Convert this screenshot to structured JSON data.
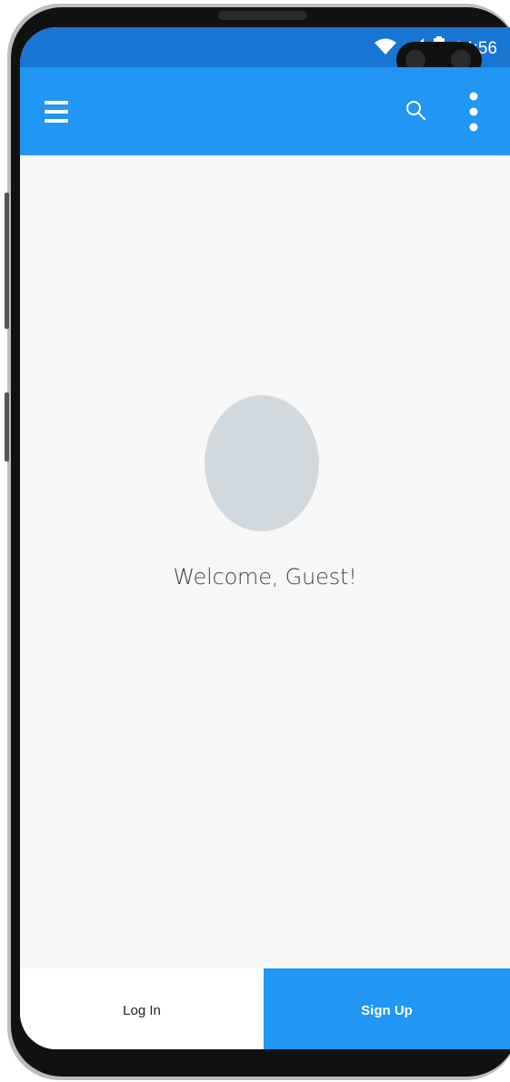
{
  "status_bar": {
    "time": "04:56",
    "icons": [
      "wifi-icon",
      "cellular-signal-icon",
      "battery-icon"
    ]
  },
  "app_bar": {
    "menu_icon": "hamburger-menu-icon",
    "search_icon": "search-icon",
    "overflow_icon": "more-vertical-icon",
    "background_color": "#2196F3",
    "status_bar_color": "#1976D2"
  },
  "main": {
    "welcome_text": "Welcome, Guest!",
    "avatar_color": "#D1D9DF"
  },
  "bottom_actions": {
    "login_label": "Log In",
    "signup_label": "Sign Up",
    "signup_color": "#2196F3"
  }
}
